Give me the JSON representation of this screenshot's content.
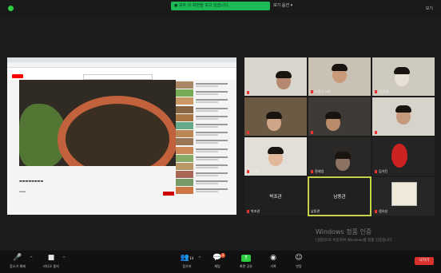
{
  "topbar": {
    "share_banner": "● 모두 의 화면을 보고 있습니다.",
    "view_option": "보기 옵션 ▾",
    "fullscreen": "보기"
  },
  "participants": [
    {
      "name": "",
      "muted": true
    },
    {
      "name": "조중선 교회",
      "muted": true
    },
    {
      "name": "김 동영",
      "muted": true
    },
    {
      "name": "",
      "muted": true
    },
    {
      "name": "",
      "muted": true
    },
    {
      "name": "",
      "muted": true
    },
    {
      "name": "조향원",
      "muted": true
    },
    {
      "name": "정세범",
      "muted": true
    },
    {
      "name": "김가진",
      "muted": true
    },
    {
      "name": "박조관",
      "muted": true,
      "center": "박조관"
    },
    {
      "name": "남동관",
      "muted": false,
      "center": "남동관",
      "active": true
    },
    {
      "name": "정유성",
      "muted": true
    }
  ],
  "watermark": {
    "title": "Windows 정품 인증",
    "subtitle": "[설정]으로 이동하여 Windows를 정품 인증합니다."
  },
  "toolbar": {
    "mute": "음소거 해제",
    "video": "비디오 중지",
    "participants": "참가자",
    "participants_count": "14",
    "chat": "채팅",
    "chat_badge": "1",
    "share": "화면 공유",
    "record": "기록",
    "reactions": "반응",
    "end": "나가기"
  }
}
